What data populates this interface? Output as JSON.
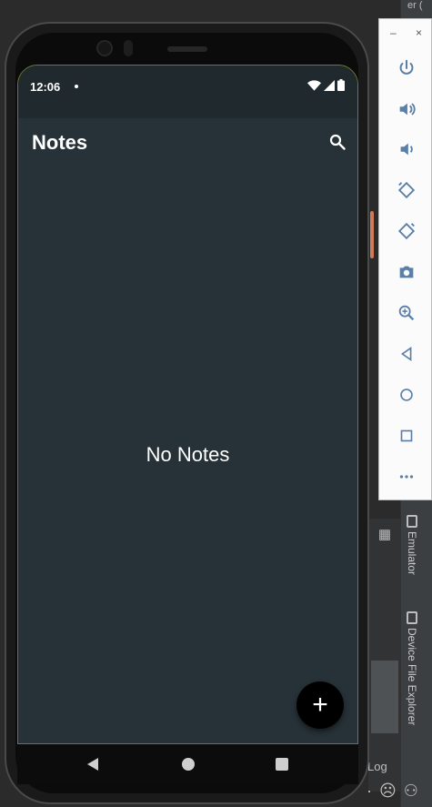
{
  "ide": {
    "top_text": "er (",
    "tabs": {
      "emulator": "Emulator",
      "device_file_explorer": "Device File Explorer"
    },
    "log_label": "Log",
    "bottom_icons": [
      "·",
      "☹",
      "⚇"
    ]
  },
  "emulator_toolbar": {
    "minimize": "–",
    "close": "×",
    "buttons": [
      "power-icon",
      "volume-up-icon",
      "volume-down-icon",
      "rotate-left-icon",
      "rotate-right-icon",
      "camera-icon",
      "zoom-icon",
      "back-icon",
      "home-icon",
      "overview-icon",
      "more-icon"
    ]
  },
  "status_bar": {
    "time": "12:06"
  },
  "app_bar": {
    "title": "Notes"
  },
  "main": {
    "empty_message": "No Notes"
  },
  "fab": {
    "icon": "+"
  },
  "colors": {
    "screen_background": "#263238",
    "status_bar_background": "#1f292e",
    "fab_background": "#000000",
    "text": "#ffffff",
    "ide_background": "#2b2b2b"
  }
}
